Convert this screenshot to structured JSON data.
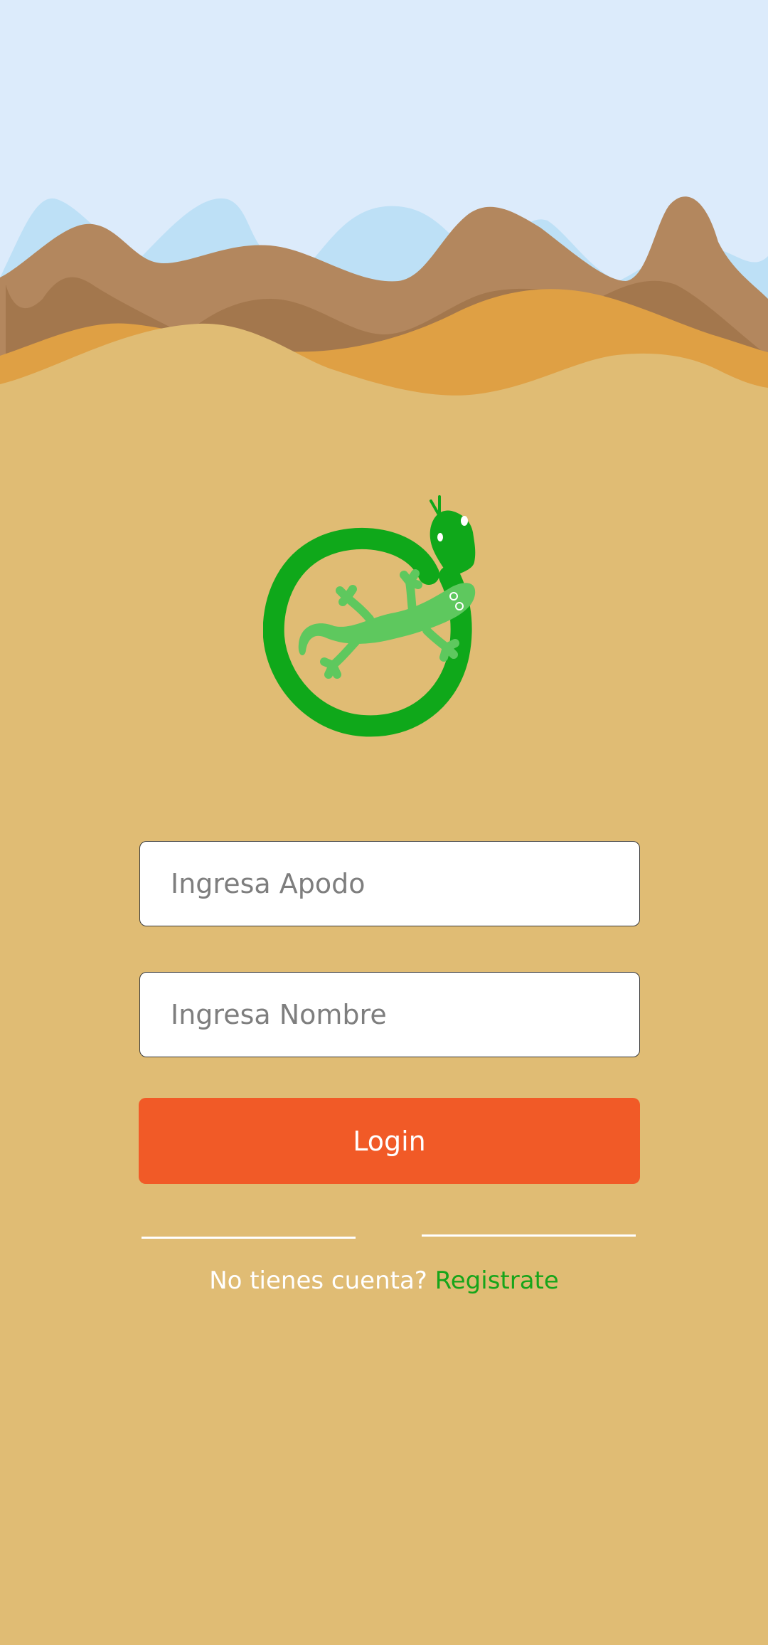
{
  "form": {
    "nickname_placeholder": "Ingresa Apodo",
    "name_placeholder": "Ingresa Nombre",
    "login_label": "Login"
  },
  "footer": {
    "prompt": "No tienes cuenta?",
    "register_label": "Registrate"
  },
  "colors": {
    "sky": "#dcebfb",
    "far_hills": "#bde0f6",
    "mountains": "#b3875e",
    "mountains_dark": "#a3774d",
    "dunes_orange": "#dfa044",
    "sand": "#e0bc74",
    "logo_green": "#0fa81a",
    "gecko_green": "#5ec85e",
    "login_button": "#f15a27",
    "register_link": "#17a51a"
  },
  "icons": {
    "logo": "snake-gecko-logo"
  }
}
